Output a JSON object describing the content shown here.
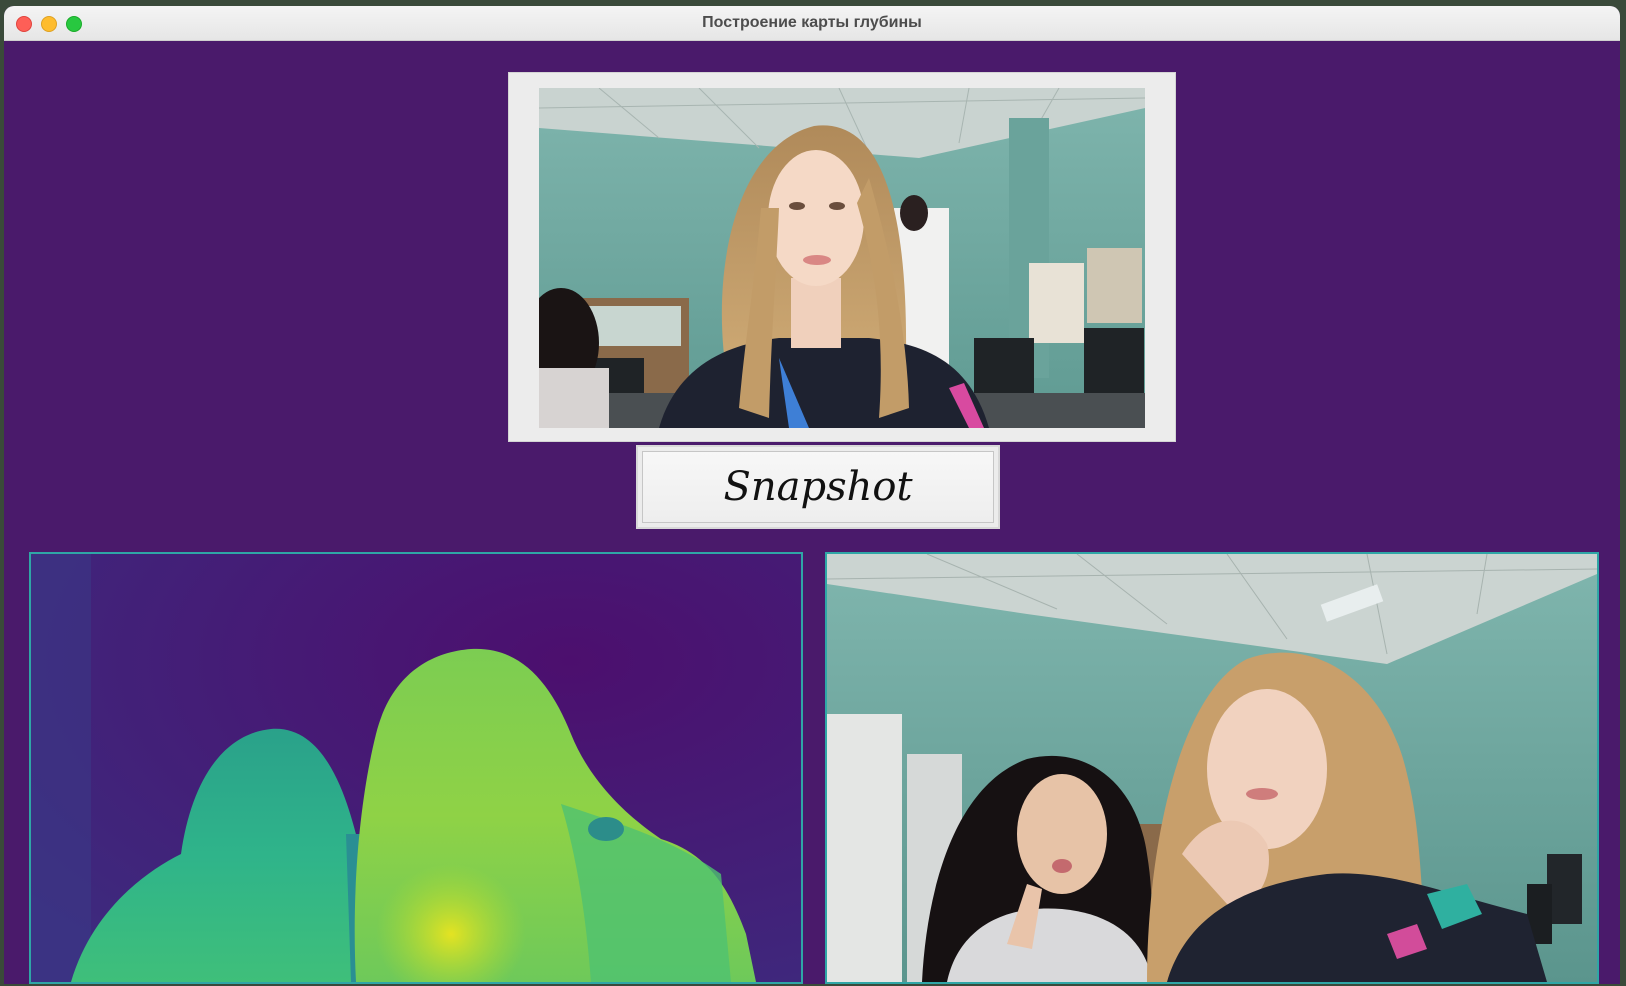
{
  "window": {
    "title": "Построение карты глубины"
  },
  "controls": {
    "snapshot_label": "Snapshot"
  },
  "colors": {
    "window_background": "#4a1a6b",
    "panel_border": "#2fa6a6",
    "button_background": "#ececec"
  },
  "icons": {
    "close": "close-traffic-light-icon",
    "minimize": "minimize-traffic-light-icon",
    "maximize": "maximize-traffic-light-icon"
  }
}
